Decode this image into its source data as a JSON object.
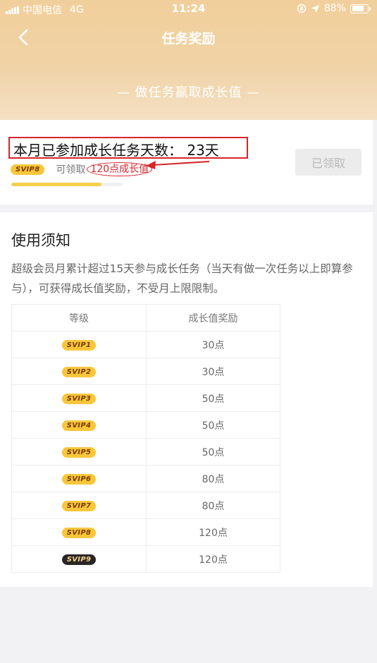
{
  "status_bar": {
    "carrier": "中国电信",
    "network": "4G",
    "time": "11:24",
    "battery": "88%"
  },
  "nav": {
    "title": "任务奖励",
    "back_icon": "chevron-left-icon"
  },
  "banner": {
    "text": "— 做任务赢取成长值 —"
  },
  "task": {
    "days_text": "本月已参加成长任务天数： 23天",
    "current_level": "SVIP8",
    "claim_label": "可领取",
    "reward": "120点成长值",
    "button_label": "已领取",
    "progress_fraction": 0.81
  },
  "notice": {
    "title": "使用须知",
    "description": "超级会员月累计超过15天参与成长任务（当天有做一次任务以上即算参与），可获得成长值奖励，不受月上限限制。",
    "table": {
      "headers": [
        "等级",
        "成长值奖励"
      ],
      "rows": [
        {
          "level": "SVIP1",
          "reward": "30点"
        },
        {
          "level": "SVIP2",
          "reward": "30点"
        },
        {
          "level": "SVIP3",
          "reward": "50点"
        },
        {
          "level": "SVIP4",
          "reward": "50点"
        },
        {
          "level": "SVIP5",
          "reward": "50点"
        },
        {
          "level": "SVIP6",
          "reward": "80点"
        },
        {
          "level": "SVIP7",
          "reward": "80点"
        },
        {
          "level": "SVIP8",
          "reward": "120点"
        },
        {
          "level": "SVIP9",
          "reward": "120点"
        }
      ]
    }
  },
  "colors": {
    "header_gold": "#f1cf9b",
    "annotation_red": "#d6242a",
    "progress_yellow": "#f5cf4a",
    "badge_gold": "#f7c63a",
    "badge_dark": "#2b2626"
  }
}
